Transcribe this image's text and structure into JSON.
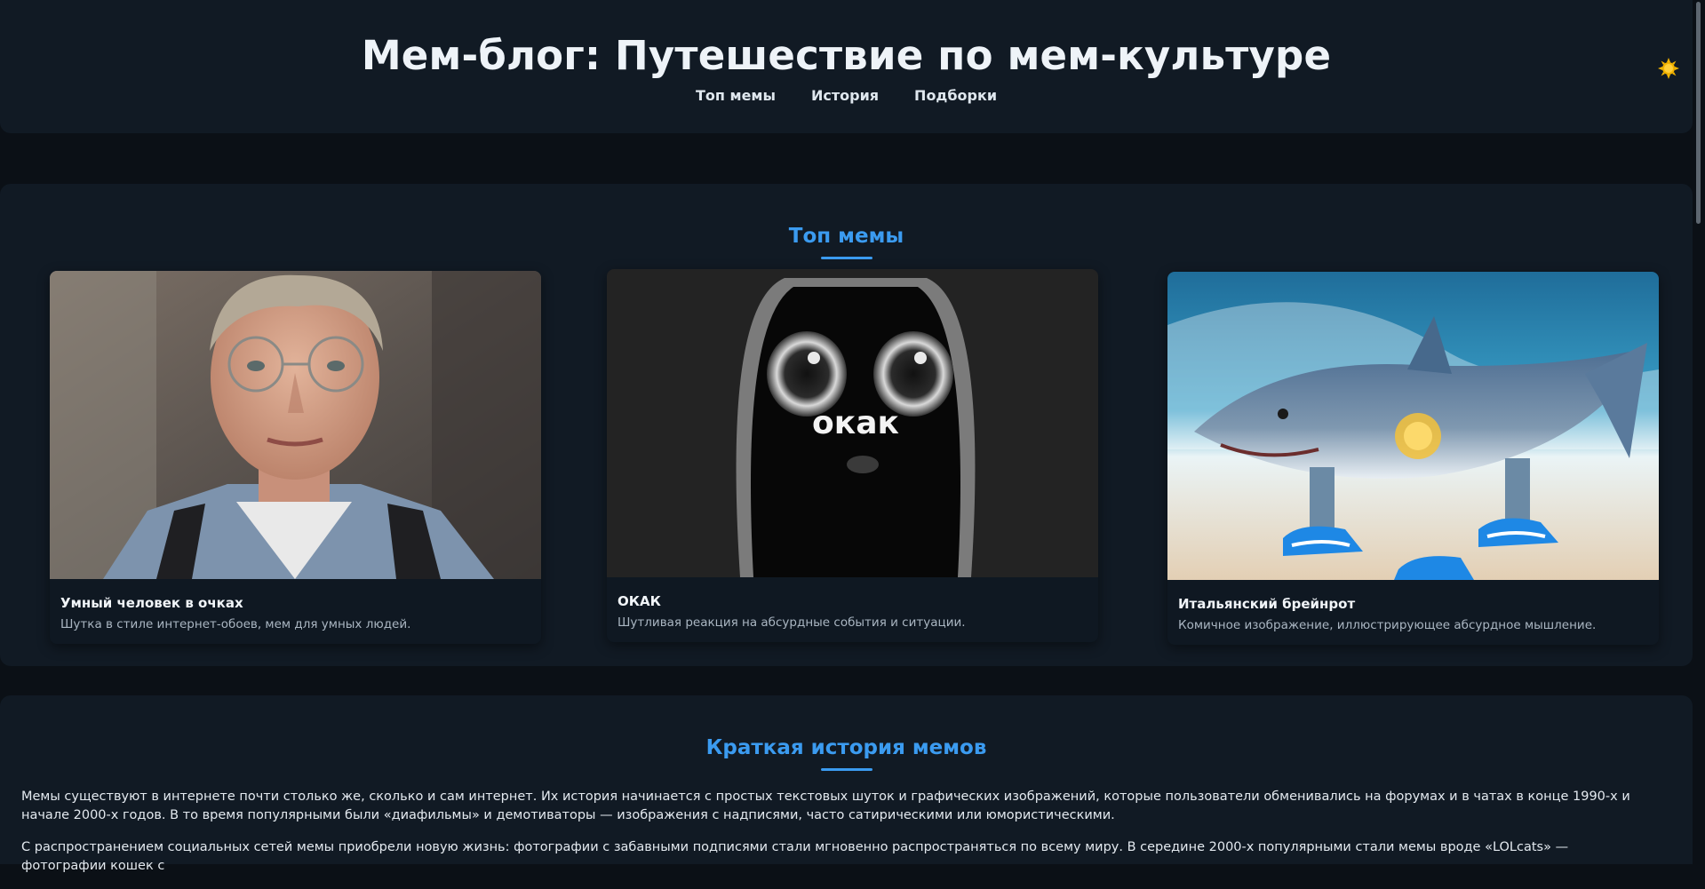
{
  "header": {
    "title": "Мем-блог: Путешествие по мем-культуре",
    "nav": [
      "Топ мемы",
      "История",
      "Подборки"
    ],
    "theme_toggle_icon": "sun-icon"
  },
  "top_memes": {
    "title": "Топ мемы",
    "cards": [
      {
        "title": "Умный человек в очках",
        "description": "Шутка в стиле интернет-обоев, мем для умных людей."
      },
      {
        "title": "ОКАК",
        "description": "Шутливая реакция на абсурдные события и ситуации.",
        "image_text": "окак"
      },
      {
        "title": "Итальянский брейнрот",
        "description": "Комичное изображение, иллюстрирующее абсурдное мышление."
      }
    ]
  },
  "history": {
    "title": "Краткая история мемов",
    "paragraphs": [
      "Мемы существуют в интернете почти столько же, сколько и сам интернет. Их история начинается с простых текстовых шуток и графических изображений, которые пользователи обменивались на форумах и в чатах в конце 1990-х и начале 2000-х годов. В то время популярными были «диафильмы» и демотиваторы — изображения с надписями, часто сатирическими или юмористическими.",
      "С распространением социальных сетей мемы приобрели новую жизнь: фотографии с забавными подписями стали мгновенно распространяться по всему миру. В середине 2000-х популярными стали мемы вроде «LOLcats» — фотографии кошек с"
    ]
  },
  "colors": {
    "accent": "#3b9bf0",
    "background": "#0b1016",
    "panel": "#111a24",
    "card": "#0f1822"
  }
}
